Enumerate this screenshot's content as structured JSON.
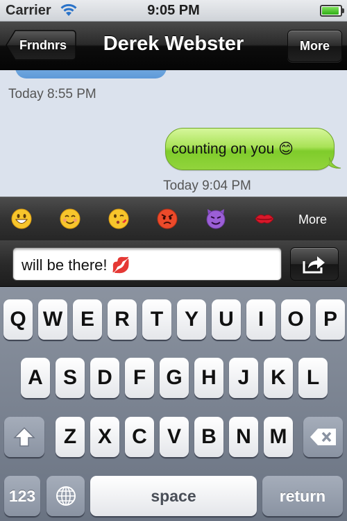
{
  "status_bar": {
    "carrier": "Carrier",
    "time": "9:05 PM",
    "battery_level": 1.0
  },
  "nav": {
    "back_label": "Frndnrs",
    "title": "Derek Webster",
    "more_label": "More"
  },
  "conversation": {
    "messages": [
      {
        "timestamp": "Today 8:55 PM"
      },
      {
        "direction": "outgoing",
        "text": "counting on you 😊",
        "timestamp": "Today 9:04 PM"
      }
    ]
  },
  "emoji_bar": {
    "emojis": [
      "grinning-face",
      "smiling-face",
      "face-blowing-kiss",
      "angry-face",
      "smiling-face-with-horns",
      "kiss-mark"
    ],
    "more_label": "More"
  },
  "composer": {
    "value": "will be there! 💋"
  },
  "keyboard": {
    "row1": [
      "Q",
      "W",
      "E",
      "R",
      "T",
      "Y",
      "U",
      "I",
      "O",
      "P"
    ],
    "row2": [
      "A",
      "S",
      "D",
      "F",
      "G",
      "H",
      "J",
      "K",
      "L"
    ],
    "row3": [
      "Z",
      "X",
      "C",
      "V",
      "B",
      "N",
      "M"
    ],
    "numbers_label": "123",
    "space_label": "space",
    "return_label": "return"
  },
  "colors": {
    "outgoing_bubble": "#a9e257",
    "conversation_bg": "#dbe2ed",
    "nav_bar": "#1a1a1a"
  }
}
